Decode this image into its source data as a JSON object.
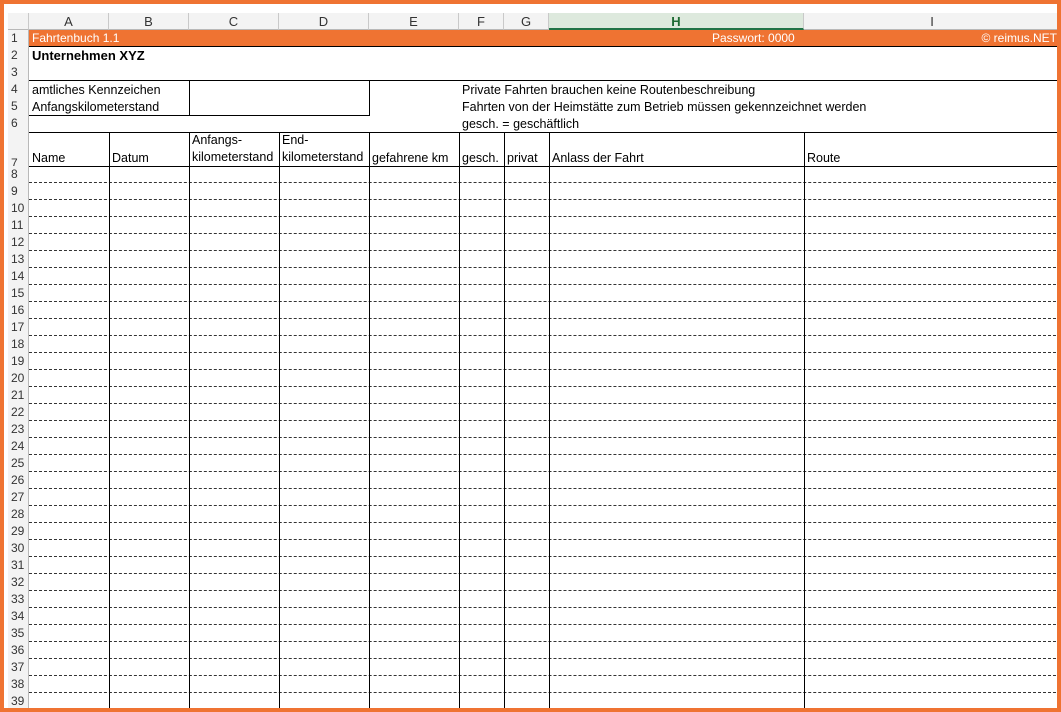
{
  "columns": [
    "A",
    "B",
    "C",
    "D",
    "E",
    "F",
    "G",
    "H",
    "I"
  ],
  "selected_column": "H",
  "rows_top": [
    "1",
    "2",
    "3",
    "4",
    "5",
    "6",
    "7"
  ],
  "rows_body": [
    "8",
    "9",
    "10",
    "11",
    "12",
    "13",
    "14",
    "15",
    "16",
    "17",
    "18",
    "19",
    "20",
    "21",
    "22",
    "23",
    "24",
    "25",
    "26",
    "27",
    "28",
    "29",
    "30",
    "31",
    "32",
    "33",
    "34",
    "35",
    "36",
    "37",
    "38",
    "39"
  ],
  "banner": {
    "title": "Fahrtenbuch 1.1",
    "password": "Passwort: 0000",
    "copyright": "© reimus.NET",
    "color": "#ef7332"
  },
  "company": "Unternehmen XYZ",
  "labels": {
    "plate": "amtliches Kennzeichen",
    "start_km": "Anfangskilometerstand"
  },
  "notes": [
    "Private Fahrten brauchen keine Routenbeschreibung",
    "Fahrten von der Heimstätte zum Betrieb müssen gekennzeichnet werden",
    "gesch. = geschäftlich"
  ],
  "table_headers": {
    "name": "Name",
    "datum": "Datum",
    "anfang_1": "Anfangs-",
    "anfang_2": "kilometerstand",
    "end_1": "End-",
    "end_2": "kilometerstand",
    "km": "gefahrene km",
    "gesch": "gesch.",
    "privat": "privat",
    "anlass": "Anlass der Fahrt",
    "route": "Route"
  }
}
